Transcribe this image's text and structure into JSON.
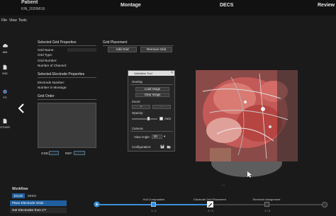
{
  "header": {
    "patient_label": "Patient",
    "patient_id": "KIN_2020MI16",
    "steps": [
      "Montage",
      "DECS",
      "Review"
    ]
  },
  "menu": [
    "File",
    "View",
    "Tools"
  ],
  "left_nav": [
    {
      "label": "MM",
      "icon": "cloud-icon"
    },
    {
      "label": "IMG",
      "icon": "document-icon"
    },
    {
      "label": "FS",
      "icon": "apple-icon"
    },
    {
      "label": "OTHER",
      "icon": "document-icon"
    }
  ],
  "grid_props": {
    "title": "Selected Grid Properties",
    "fields": [
      "Grid Name:",
      "Grid Type:",
      "Grid Number:",
      "Number of Channel:"
    ]
  },
  "electrode_props": {
    "title": "Selected Electrode Properties",
    "fields": [
      "Electrode Number:",
      "Number in Montage:"
    ]
  },
  "grid_order": {
    "title": "Grid Order",
    "gnd_label": "GND:",
    "ref_label": "REF:"
  },
  "grid_placement": {
    "title": "Grid Placement",
    "add_label": "Add Grid",
    "remove_label": "Remove Grid"
  },
  "validation_panel": {
    "title": "Validation Tool",
    "close": "×",
    "overlay_title": "Overlay",
    "load_image": "Load Image",
    "clear_image": "Clear Image",
    "zoom_label": "Zoom:",
    "zoom_plus": "+",
    "zoom_minus": "-",
    "opacity_label": "Opacity:",
    "opacity_value": 0.65,
    "auto_label": "Auto",
    "camera_title": "Camera",
    "view_angle_label": "View Angle:",
    "view_angle_value": "30",
    "configuration_label": "Configuration:"
  },
  "workflow": {
    "title": "Workflow",
    "tabs": [
      "ECoG",
      "SEEG"
    ],
    "items": [
      "Place Electrode Grids",
      "Get Electrodes from CT"
    ]
  },
  "progress": {
    "steps": [
      {
        "caption": "Hull Computation",
        "count": "1 / 1"
      },
      {
        "caption": "Electrode Grid Placement",
        "count": "2 / 3"
      },
      {
        "caption": "Electrode Assignment",
        "count": "1 / 3"
      }
    ],
    "fraction": 0.48
  },
  "colors": {
    "accent": "#3a8fd8",
    "active_item": "#1f5f9f"
  }
}
